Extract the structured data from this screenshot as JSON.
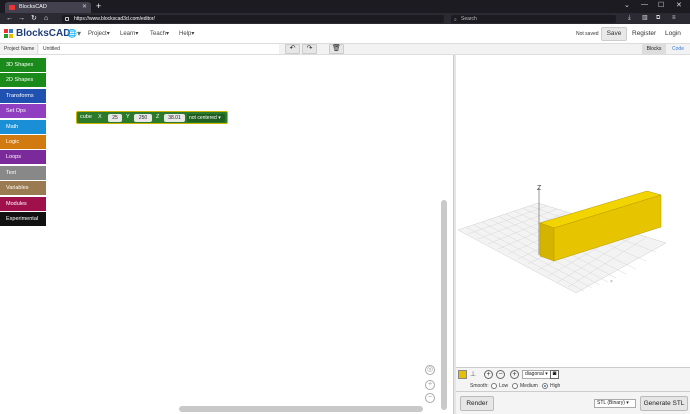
{
  "browser": {
    "tab_title": "BlocksCAD",
    "url": "https://www.blockscad3d.com/editor/",
    "search_placeholder": "Search"
  },
  "header": {
    "logo_text": "BlocksCAD",
    "menus": [
      "Project",
      "Learn",
      "Teach",
      "Help"
    ],
    "save_status": "Not saved",
    "save_label": "Save",
    "register_label": "Register",
    "login_label": "Login"
  },
  "toolbar": {
    "project_name_label": "Project Name",
    "project_name_value": "Untitled",
    "tabs": {
      "blocks": "Blocks",
      "code": "Code"
    }
  },
  "categories": [
    {
      "label": "3D Shapes",
      "color": "#1a8a1a"
    },
    {
      "label": "2D Shapes",
      "color": "#1a8a1a"
    },
    {
      "label": "Transforms",
      "color": "#2050b0"
    },
    {
      "label": "Set Ops",
      "color": "#8f3fbf"
    },
    {
      "label": "Math",
      "color": "#1a8fd6"
    },
    {
      "label": "Logic",
      "color": "#d07a10"
    },
    {
      "label": "Loops",
      "color": "#7a2a9a"
    },
    {
      "label": "Text",
      "color": "#888888"
    },
    {
      "label": "Variables",
      "color": "#9a7a50"
    },
    {
      "label": "Modules",
      "color": "#a0104a"
    },
    {
      "label": "Experimental",
      "color": "#111111"
    }
  ],
  "block": {
    "name": "cube",
    "x_label": "X",
    "x_value": "25",
    "y_label": "Y",
    "y_value": "250",
    "z_label": "Z",
    "z_value": "38.01",
    "center_option": "not centered"
  },
  "viewer": {
    "axis_z": "Z",
    "view_option": "diagonal",
    "smooth_label": "Smooth:",
    "smooth_options": [
      "Low",
      "Medium",
      "High"
    ],
    "smooth_selected": "High",
    "render_label": "Render",
    "format_option": "STL (Binary)",
    "generate_label": "Generate STL",
    "object_color": "#e6c000"
  }
}
